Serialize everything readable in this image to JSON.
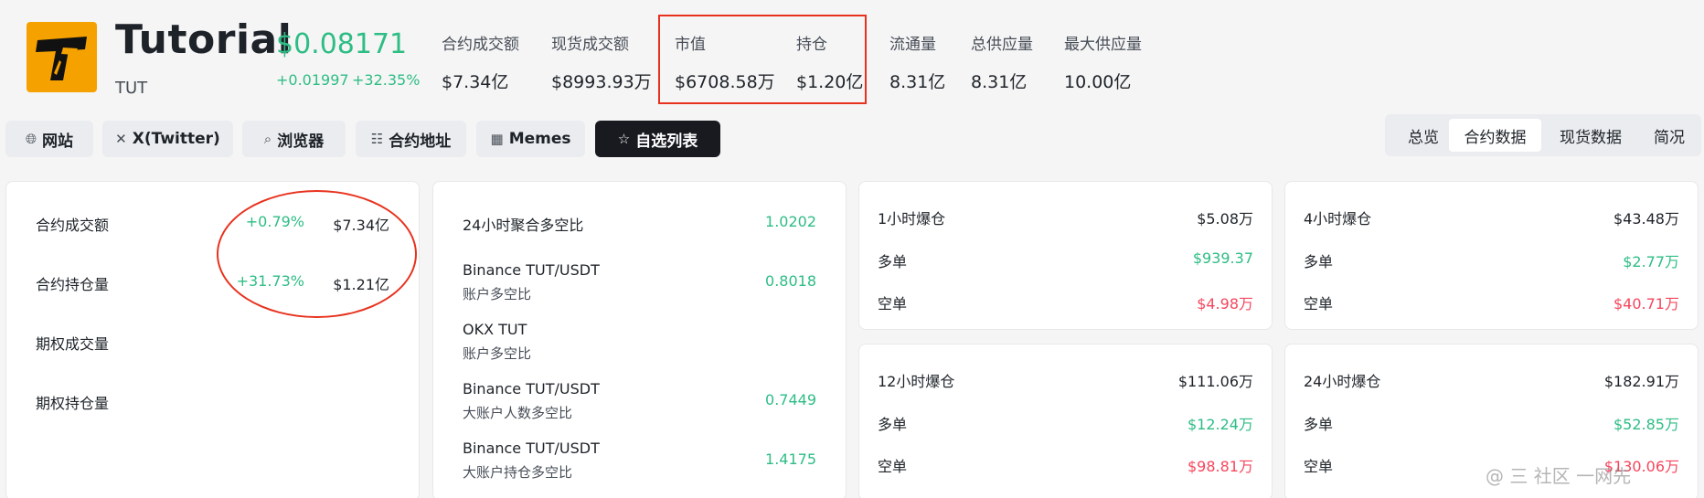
{
  "coin": {
    "name": "Tutorial",
    "symbol": "TUT",
    "price": "$0.08171",
    "change_abs": "+0.01997",
    "change_pct": "+32.35%"
  },
  "stats": [
    {
      "label": "合约成交额",
      "value": "$7.34亿"
    },
    {
      "label": "现货成交额",
      "value": "$8993.93万"
    },
    {
      "label": "市值",
      "value": "$6708.58万"
    },
    {
      "label": "持仓",
      "value": "$1.20亿"
    },
    {
      "label": "流通量",
      "value": "8.31亿"
    },
    {
      "label": "总供应量",
      "value": "8.31亿"
    },
    {
      "label": "最大供应量",
      "value": "10.00亿"
    }
  ],
  "links": [
    {
      "label": "网站",
      "icon": "globe-icon"
    },
    {
      "label": "X(Twitter)",
      "icon": "x-icon"
    },
    {
      "label": "浏览器",
      "icon": "explorer-icon"
    },
    {
      "label": "合约地址",
      "icon": "document-icon"
    },
    {
      "label": "Memes",
      "icon": "grid-icon"
    },
    {
      "label": "自选列表",
      "icon": "star-icon"
    }
  ],
  "view_tabs": [
    "总览",
    "合约数据",
    "现货数据",
    "简况"
  ],
  "active_tab": "合约数据",
  "volume_card": [
    {
      "label": "合约成交额",
      "change": "+0.79%",
      "value": "$7.34亿"
    },
    {
      "label": "合约持仓量",
      "change": "+31.73%",
      "value": "$1.21亿"
    },
    {
      "label": "期权成交量",
      "change": "",
      "value": ""
    },
    {
      "label": "期权持仓量",
      "change": "",
      "value": ""
    }
  ],
  "ratio_card": [
    {
      "title": "24小时聚合多空比",
      "sub": "",
      "value": "1.0202"
    },
    {
      "title": "Binance TUT/USDT",
      "sub": "账户多空比",
      "value": "0.8018"
    },
    {
      "title": "OKX TUT",
      "sub": "账户多空比",
      "value": ""
    },
    {
      "title": "Binance TUT/USDT",
      "sub": "大账户人数多空比",
      "value": "0.7449"
    },
    {
      "title": "Binance TUT/USDT",
      "sub": "大账户持仓多空比",
      "value": "1.4175"
    }
  ],
  "liquidations": [
    {
      "title": "1小时爆仓",
      "total": "$5.08万",
      "long_label": "多单",
      "long": "$939.37",
      "short_label": "空单",
      "short": "$4.98万"
    },
    {
      "title": "4小时爆仓",
      "total": "$43.48万",
      "long_label": "多单",
      "long": "$2.77万",
      "short_label": "空单",
      "short": "$40.71万"
    },
    {
      "title": "12小时爆仓",
      "total": "$111.06万",
      "long_label": "多单",
      "long": "$12.24万",
      "short_label": "空单",
      "short": "$98.81万"
    },
    {
      "title": "24小时爆仓",
      "total": "$182.91万",
      "long_label": "多单",
      "long": "$52.85万",
      "short_label": "空单",
      "short": "$130.06万"
    }
  ],
  "watermark": "@ 三 社区 一网先"
}
